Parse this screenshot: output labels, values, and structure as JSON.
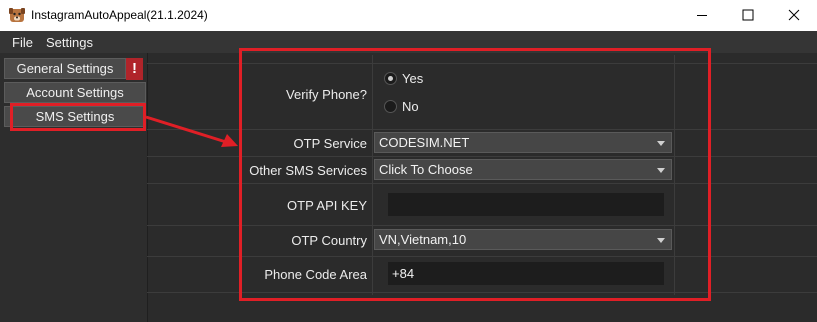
{
  "window": {
    "title": "InstagramAutoAppeal(21.1.2024)",
    "icon": "dog-app-icon"
  },
  "menu": {
    "file": "File",
    "settings": "Settings"
  },
  "sidebar": {
    "items": [
      {
        "label": "General Settings"
      },
      {
        "label": "Account Settings"
      },
      {
        "label": "SMS Settings"
      }
    ],
    "warning_badge": "!"
  },
  "form": {
    "verify_phone": {
      "label": "Verify Phone?",
      "options": [
        "Yes",
        "No"
      ],
      "selected": "Yes"
    },
    "otp_service": {
      "label": "OTP Service",
      "value": "CODESIM.NET"
    },
    "other_sms": {
      "label": "Other SMS Services",
      "value": "Click To Choose"
    },
    "otp_api_key": {
      "label": "OTP API KEY",
      "value": ""
    },
    "otp_country": {
      "label": "OTP Country",
      "value": "VN,Vietnam,10"
    },
    "phone_code_area": {
      "label": "Phone Code Area",
      "value": "+84"
    }
  },
  "annotation": {
    "highlight_color": "#e01f26"
  }
}
